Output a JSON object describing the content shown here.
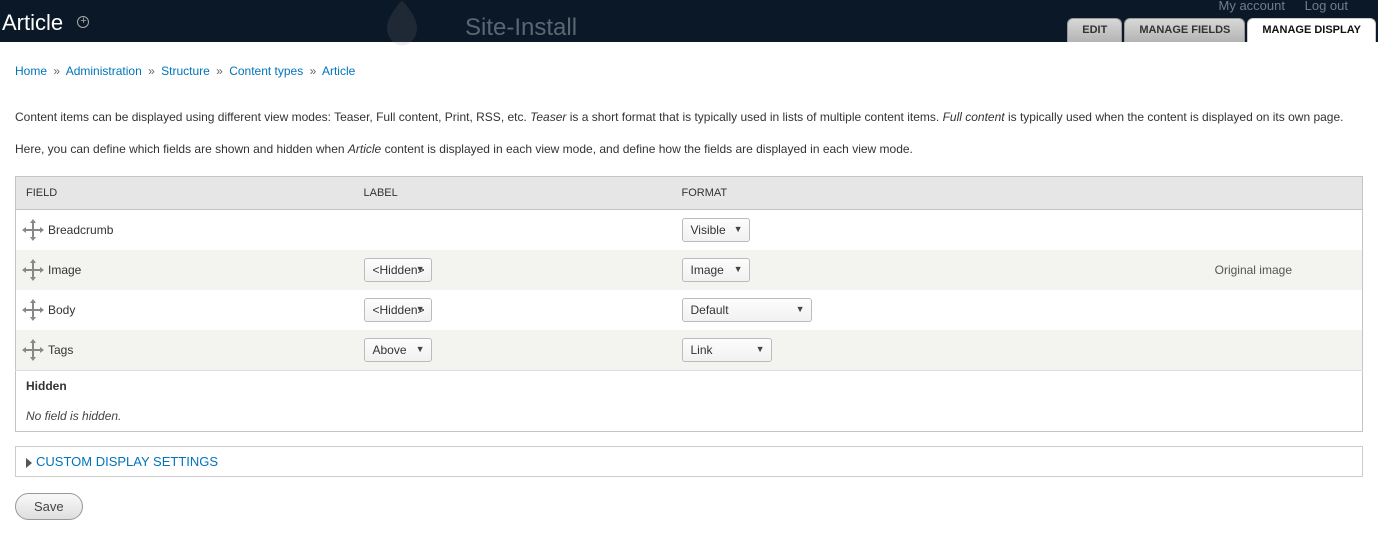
{
  "toolbar": {
    "title": "Article",
    "site_name": "Site-Install",
    "user_links": {
      "account": "My account",
      "logout": "Log out"
    },
    "tabs": {
      "edit": "EDIT",
      "fields": "MANAGE FIELDS",
      "display": "MANAGE DISPLAY"
    }
  },
  "breadcrumb": {
    "items": [
      "Home",
      "Administration",
      "Structure",
      "Content types",
      "Article"
    ],
    "sep": "»"
  },
  "intro": {
    "p1a": "Content items can be displayed using different view modes: Teaser, Full content, Print, RSS, etc. ",
    "p1b": "Teaser",
    "p1c": " is a short format that is typically used in lists of multiple content items. ",
    "p1d": "Full content",
    "p1e": " is typically used when the content is displayed on its own page.",
    "p2a": "Here, you can define which fields are shown and hidden when ",
    "p2b": "Article",
    "p2c": " content is displayed in each view mode, and define how the fields are displayed in each view mode."
  },
  "table": {
    "headers": {
      "field": "FIELD",
      "label": "LABEL",
      "format": "FORMAT"
    },
    "rows": [
      {
        "field": "Breadcrumb",
        "label": "",
        "format": "Visible",
        "summary": ""
      },
      {
        "field": "Image",
        "label": "<Hidden>",
        "format": "Image",
        "summary": "Original image"
      },
      {
        "field": "Body",
        "label": "<Hidden>",
        "format": "Default",
        "summary": ""
      },
      {
        "field": "Tags",
        "label": "Above",
        "format": "Link",
        "summary": ""
      }
    ],
    "hidden_region": "Hidden",
    "hidden_empty": "No field is hidden."
  },
  "fieldset": {
    "title": "CUSTOM DISPLAY SETTINGS"
  },
  "actions": {
    "save": "Save"
  }
}
